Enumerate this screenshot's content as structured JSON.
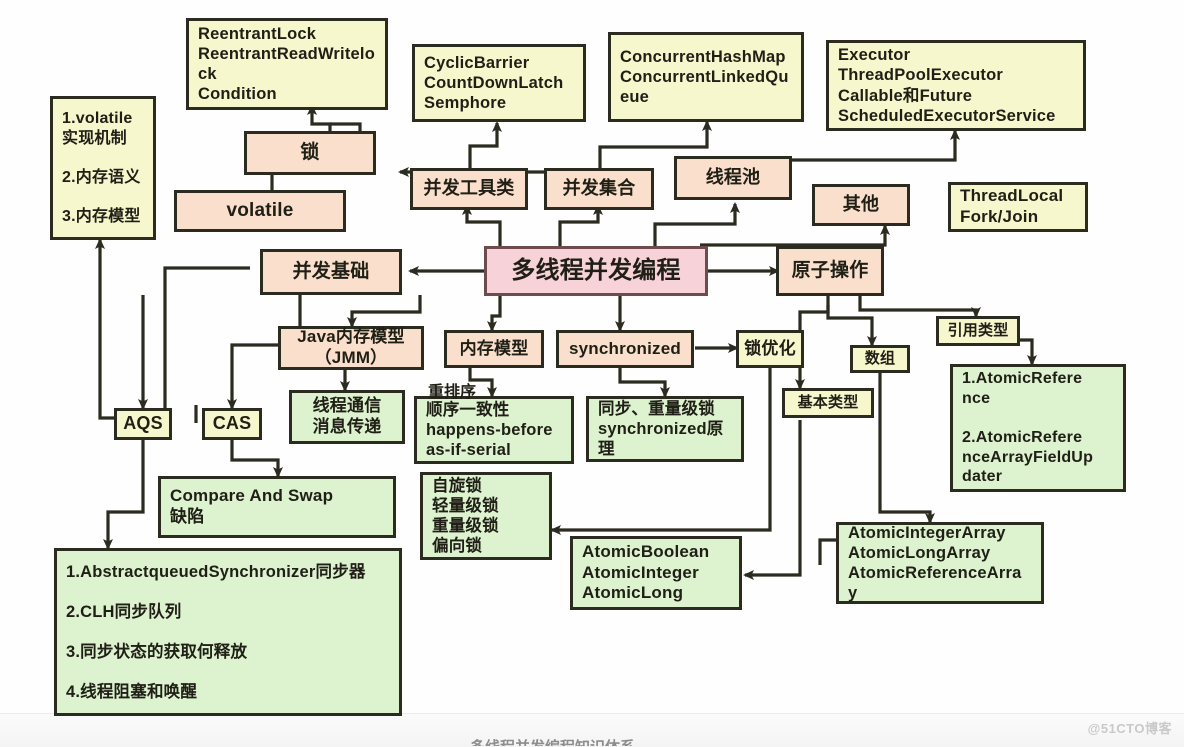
{
  "diagram": {
    "title": "多线程并发编程",
    "colors": {
      "yellow": "#f7f7ce",
      "peach": "#fae0cc",
      "green": "#ddf2cf",
      "pink": "#f8d2d9",
      "border": "#2b2b20",
      "background": "#ffffff"
    },
    "center_node": {
      "label": "多线程并发编程"
    },
    "nodes": {
      "reentrant_lock": {
        "label": "ReentrantLock\nReentrantReadWritelo\nck\nCondition"
      },
      "cyclic_barrier": {
        "label": "CyclicBarrier\nCountDownLatch\nSemphore"
      },
      "concurrent_map": {
        "label": "ConcurrentHashMap\nConcurrentLinkedQu\neue"
      },
      "executor": {
        "label": "Executor\nThreadPoolExecutor\nCallable和Future\nScheduledExecutorService"
      },
      "volatile_detail": {
        "label": "1.volatile\n实现机制\n\n2.内存语义\n\n3.内存模型"
      },
      "lock": {
        "label": "锁"
      },
      "volatile": {
        "label": "volatile"
      },
      "concurrent_tools": {
        "label": "并发工具类"
      },
      "concurrent_collections": {
        "label": "并发集合"
      },
      "thread_pool": {
        "label": "线程池"
      },
      "other": {
        "label": "其他"
      },
      "threadlocal": {
        "label": "ThreadLocal\nFork/Join"
      },
      "concurrency_basics": {
        "label": "并发基础"
      },
      "atomic_ops": {
        "label": "原子操作"
      },
      "jmm": {
        "label": "Java内存模型\n（JMM）"
      },
      "memory_model": {
        "label": "内存模型"
      },
      "synchronized": {
        "label": "synchronized"
      },
      "lock_optimization": {
        "label": "锁优化"
      },
      "reference_type": {
        "label": "引用类型"
      },
      "array_type": {
        "label": "数组"
      },
      "primitive_type": {
        "label": "基本类型"
      },
      "thread_comm": {
        "label": "线程通信\n消息传递"
      },
      "reorder_detail": {
        "label": "顺序一致性\nhappens-before\nas-if-serial"
      },
      "sync_heavy_lock": {
        "label": "同步、重量级锁\nsynchronized原\n理"
      },
      "atomic_reference": {
        "label": "1.AtomicRefere\nnce\n\n2.AtomicRefere\nnceArrayFieldUp\ndater"
      },
      "aqs": {
        "label": "AQS"
      },
      "cas": {
        "label": "CAS"
      },
      "compare_and_swap": {
        "label": "Compare And Swap\n缺陷"
      },
      "lock_types": {
        "label": "自旋锁\n轻量级锁\n重量级锁\n偏向锁"
      },
      "atomic_basic": {
        "label": "AtomicBoolean\nAtomicInteger\nAtomicLong"
      },
      "atomic_array": {
        "label": "AtomicIntegerArray\nAtomicLongArray\nAtomicReferenceArra\ny"
      },
      "aqs_detail": {
        "label": "1.AbstractqueuedSynchronizer同步器\n\n2.CLH同步队列\n\n3.同步状态的获取何释放\n\n4.线程阻塞和唤醒"
      }
    },
    "labels": {
      "reorder": "重排序"
    },
    "watermark": "@51CTO博客",
    "cut_off_text": "多线程并发编程知识体系"
  }
}
